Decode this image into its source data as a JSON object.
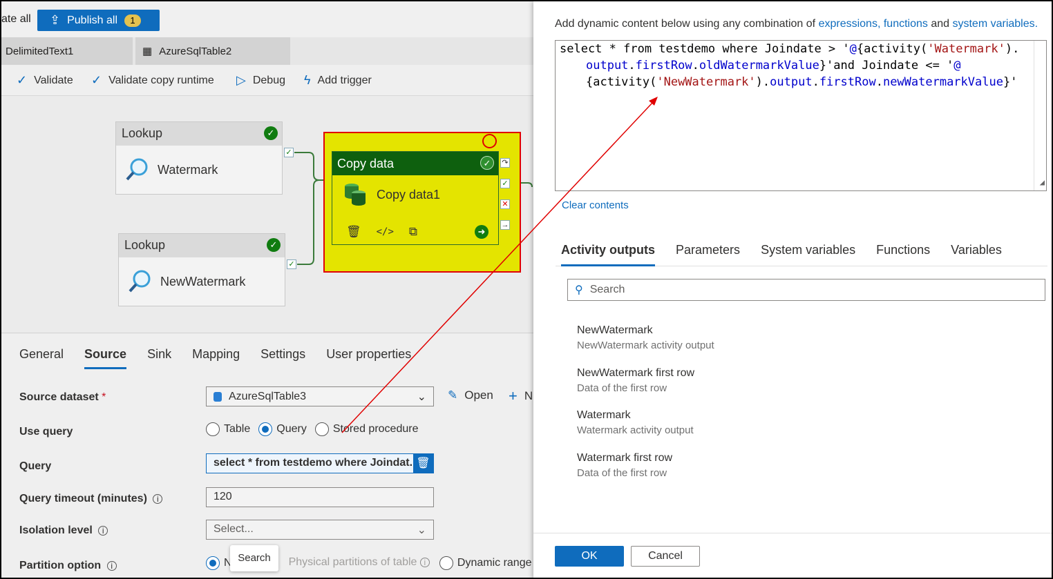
{
  "topbar": {
    "truncated_label": "ate all",
    "publish_label": "Publish all",
    "publish_count": "1"
  },
  "doc_tabs": [
    {
      "label": "DelimitedText1"
    },
    {
      "label": "AzureSqlTable2"
    }
  ],
  "toolbar": {
    "validate": "Validate",
    "validate_copy_runtime": "Validate copy runtime",
    "debug": "Debug",
    "add_trigger": "Add trigger"
  },
  "canvas": {
    "lookup1": {
      "type": "Lookup",
      "name": "Watermark"
    },
    "lookup2": {
      "type": "Lookup",
      "name": "NewWatermark"
    },
    "copy": {
      "type": "Copy data",
      "name": "Copy data1"
    }
  },
  "props": {
    "tabs": [
      "General",
      "Source",
      "Sink",
      "Mapping",
      "Settings",
      "User properties"
    ],
    "active_tab": "Source",
    "source_dataset_label": "Source dataset",
    "required_mark": "*",
    "source_dataset_value": "AzureSqlTable3",
    "open_label": "Open",
    "new_label_truncated": "N",
    "use_query_label": "Use query",
    "use_query_options": [
      "Table",
      "Query",
      "Stored procedure"
    ],
    "query_label": "Query",
    "query_value": "select * from testdemo where Joindat...",
    "timeout_label": "Query timeout (minutes)",
    "timeout_value": "120",
    "isolation_label": "Isolation level",
    "isolation_placeholder": "Select...",
    "partition_label": "Partition option",
    "partition_options": [
      "N",
      "Physical partitions of table",
      "Dynamic range"
    ],
    "tooltip": "Search"
  },
  "pane": {
    "intro_prefix": "Add dynamic content below using any combination of ",
    "link_expressions": "expressions,",
    "link_functions": "functions",
    "intro_and": " and ",
    "link_sysvars": "system variables.",
    "expr": {
      "p1": "select * from testdemo where Joindate > '",
      "at1": "@",
      "p2": "{activity(",
      "s1": "'Watermark'",
      "p3": ").",
      "l2a": "output",
      "l2b": ".",
      "l2c": "firstRow",
      "l2d": ".",
      "l2e": "oldWatermarkValue",
      "l2f": "}'and Joindate <= '",
      "at2": "@",
      "l3a": "{activity(",
      "s2": "'NewWatermark'",
      "l3b": ").",
      "l3c": "output",
      "l3d": ".",
      "l3e": "firstRow",
      "l3f": ".",
      "l3g": "newWatermarkValue",
      "l3h": "}'"
    },
    "clear_contents": "Clear contents",
    "tabs": [
      "Activity outputs",
      "Parameters",
      "System variables",
      "Functions",
      "Variables"
    ],
    "search_placeholder": "Search",
    "items": [
      {
        "title": "NewWatermark",
        "sub": "NewWatermark activity output"
      },
      {
        "title": "NewWatermark first row",
        "sub": "Data of the first row"
      },
      {
        "title": "Watermark",
        "sub": "Watermark activity output"
      },
      {
        "title": "Watermark first row",
        "sub": "Data of the first row"
      }
    ],
    "ok_label": "OK",
    "cancel_label": "Cancel"
  }
}
